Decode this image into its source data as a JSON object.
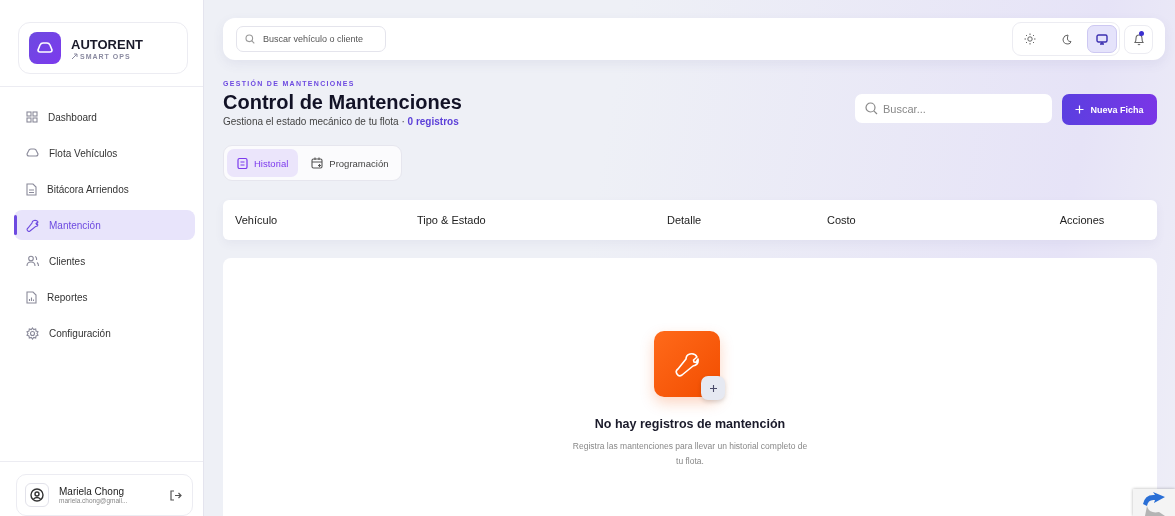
{
  "brand": {
    "name": "AUTORENT",
    "tagline": "SMART OPS"
  },
  "sidebar": {
    "items": [
      {
        "label": "Dashboard",
        "selected": false
      },
      {
        "label": "Flota Vehículos",
        "selected": false
      },
      {
        "label": "Bitácora Arriendos",
        "selected": false
      },
      {
        "label": "Mantención",
        "selected": true
      },
      {
        "label": "Clientes",
        "selected": false
      },
      {
        "label": "Reportes",
        "selected": false
      },
      {
        "label": "Configuración",
        "selected": false
      }
    ]
  },
  "user": {
    "name": "Mariela Chong",
    "email": "mariela.chong@gmail..."
  },
  "topbar": {
    "search": {
      "placeholder": "Buscar vehículo o cliente"
    },
    "theme_options": [
      {
        "kind": "light",
        "selected": false
      },
      {
        "kind": "dark",
        "selected": false
      },
      {
        "kind": "system",
        "selected": true
      }
    ],
    "notifications": {
      "unread": true
    }
  },
  "header": {
    "eyebrow": "GESTIÓN DE MANTENCIONES",
    "title": "Control de Mantenciones",
    "subtitle": "Gestiona el estado mecánico de tu flota · ",
    "count": "0 registros",
    "search": {
      "placeholder": "Buscar..."
    },
    "button": "Nueva Ficha"
  },
  "tabs": [
    {
      "label": "Historial",
      "selected": true
    },
    {
      "label": "Programación",
      "selected": false
    }
  ],
  "table": {
    "columns": [
      "Vehículo",
      "Tipo & Estado",
      "Detalle",
      "Costo",
      "Acciones"
    ]
  },
  "empty_state": {
    "title": "No hay registros de mantención",
    "description": "Registra las mantenciones para llevar un historial completo de tu flota."
  }
}
